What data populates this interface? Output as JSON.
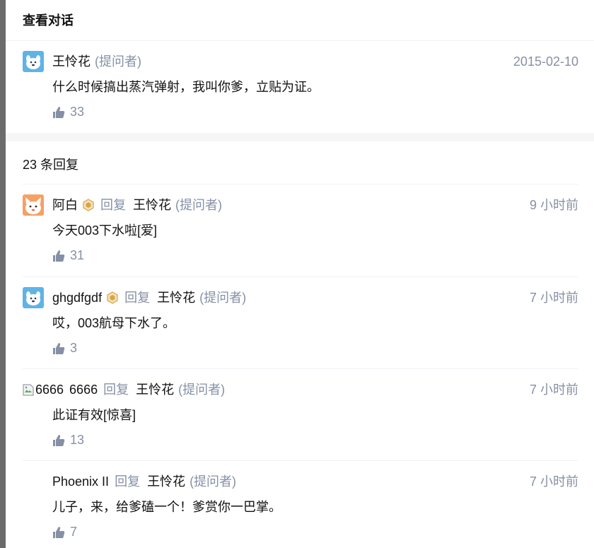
{
  "header": {
    "title": "查看对话"
  },
  "question": {
    "author": "王怜花",
    "role": "(提问者)",
    "date": "2015-02-10",
    "text": "什么时候搞出蒸汽弹射，我叫你爹，立贴为证。",
    "likes": "33",
    "avatar_icon": "cartoon-dog-avatar-icon"
  },
  "replies_count": "23 条回复",
  "reply_label": "回复",
  "comments": [
    {
      "author": "阿白",
      "badge_icon": "hexagon-badge-icon",
      "reply_to": "王怜花",
      "reply_to_role": "(提问者)",
      "time": "9 小时前",
      "text": "今天003下水啦[爱]",
      "likes": "31",
      "avatar_icon": "cartoon-cat-avatar-icon"
    },
    {
      "author": "ghgdfgdf",
      "badge_icon": "hexagon-badge-icon",
      "reply_to": "王怜花",
      "reply_to_role": "(提问者)",
      "time": "7 小时前",
      "text": "哎，003航母下水了。",
      "likes": "3",
      "avatar_icon": "cartoon-dog-avatar-icon"
    },
    {
      "author": "6666",
      "avatar_alt": "6666",
      "reply_to": "王怜花",
      "reply_to_role": "(提问者)",
      "time": "7 小时前",
      "text": "此证有效[惊喜]",
      "likes": "13",
      "avatar_icon": "broken-image-icon"
    },
    {
      "author": "Phoenix II",
      "reply_to": "王怜花",
      "reply_to_role": "(提问者)",
      "time": "7 小时前",
      "text": "儿子，来，给爹磕一个！爹赏你一巴掌。",
      "likes": "7"
    }
  ],
  "colors": {
    "text": "#121212",
    "muted": "#8590a6",
    "divider": "#f0f2f7",
    "band": "#f6f6f6",
    "badge": "#d9a441"
  }
}
